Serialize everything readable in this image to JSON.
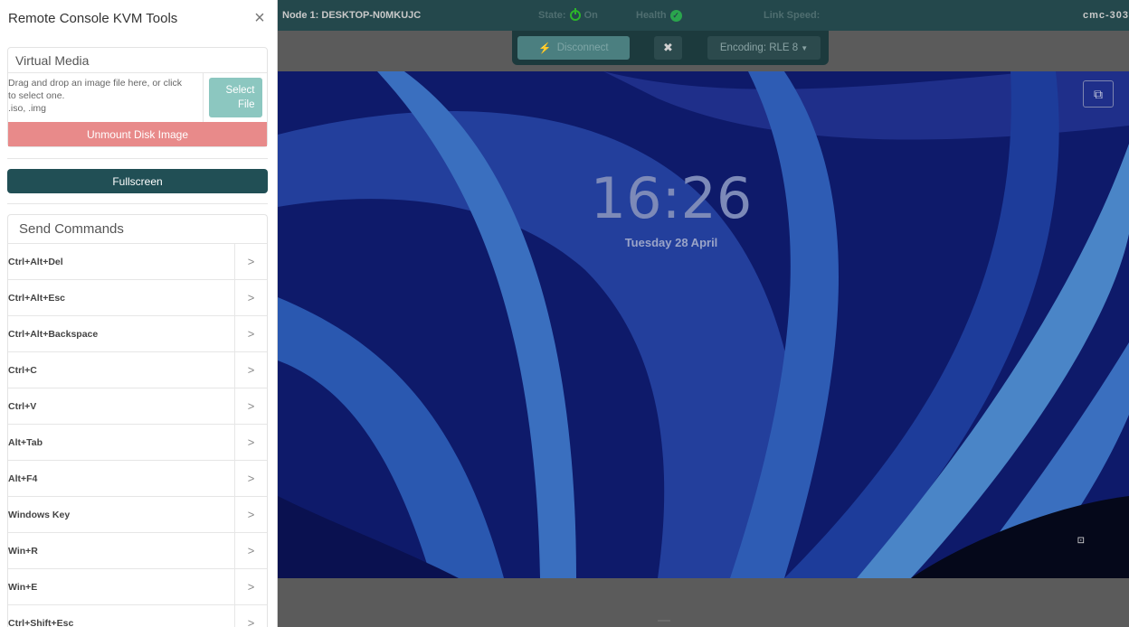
{
  "sidebar": {
    "title": "Remote Console KVM Tools",
    "close_icon": "close-icon",
    "virtual_media": {
      "heading": "Virtual Media",
      "drop_text_line1": "Drag and drop an image file here, or click",
      "drop_text_line2": "to select one.",
      "drop_text_line3": ".iso, .img",
      "select_line1": "Select",
      "select_line2": "File",
      "unmount_label": "Unmount Disk Image"
    },
    "fullscreen_label": "Fullscreen",
    "send_commands": {
      "heading": "Send Commands",
      "items": [
        {
          "label": "Ctrl+Alt+Del"
        },
        {
          "label": "Ctrl+Alt+Esc"
        },
        {
          "label": "Ctrl+Alt+Backspace"
        },
        {
          "label": "Ctrl+C"
        },
        {
          "label": "Ctrl+V"
        },
        {
          "label": "Alt+Tab"
        },
        {
          "label": "Alt+F4"
        },
        {
          "label": "Windows Key"
        },
        {
          "label": "Win+R"
        },
        {
          "label": "Win+E"
        },
        {
          "label": "Ctrl+Shift+Esc"
        }
      ]
    }
  },
  "topbar": {
    "node": "Node 1: DESKTOP-N0MKUJC",
    "state_label": "State:",
    "state_value": "On",
    "health_label": "Health",
    "link_speed_label": "Link Speed:",
    "host": "cmc-303"
  },
  "toolbar": {
    "disconnect_label": "Disconnect",
    "encoding_label": "Encoding: RLE 8",
    "tools_icon": "tools-icon"
  },
  "screen": {
    "time": "16:26",
    "date": "Tuesday 28 April",
    "colors": {
      "background": "#0e1a6a",
      "ribbon": "#2a58b0",
      "ribbon_light": "#4a85c7"
    }
  }
}
